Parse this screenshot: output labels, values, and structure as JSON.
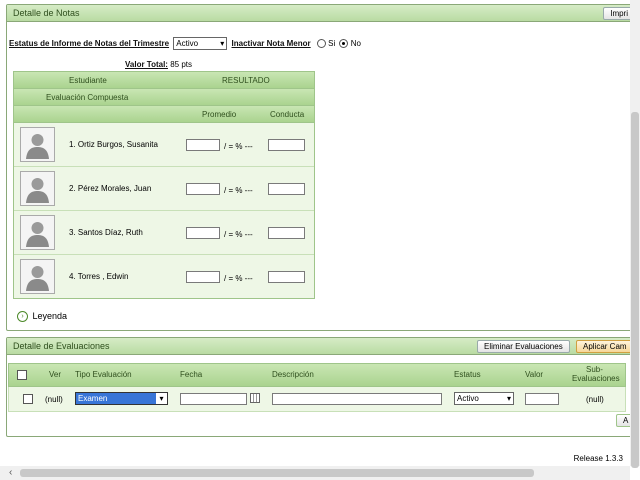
{
  "notas": {
    "title": "Detalle de Notas",
    "print_label": "Impri",
    "status_label": "Estatus de Informe de Notas del Trimestre",
    "status_value": "Activo",
    "inactivar_label": "Inactivar Nota Menor",
    "si_label": "Si",
    "no_label": "No",
    "valor_total_label": "Valor Total:",
    "valor_total_value": "85 pts",
    "headers": {
      "estudiante": "Estudiante",
      "resultado": "RESULTADO",
      "evaluacion": "Evaluación Compuesta",
      "promedio": "Promedio",
      "conducta": "Conducta"
    },
    "pct_label": "/ = % ---",
    "students": [
      {
        "name": "1. Ortiz Burgos, Susanita"
      },
      {
        "name": "2. Pérez Morales, Juan"
      },
      {
        "name": "3. Santos Díaz, Ruth"
      },
      {
        "name": "4. Torres , Edwin"
      }
    ],
    "leyenda": "Leyenda"
  },
  "evaluaciones": {
    "title": "Detalle de Evaluaciones",
    "eliminar_label": "Eliminar Evaluaciones",
    "aplicar_label": "Aplicar Cam",
    "columns": {
      "ver": "Ver",
      "tipo": "Tipo Evaluación",
      "fecha": "Fecha",
      "descripcion": "Descripción",
      "estatus": "Estatus",
      "valor": "Valor",
      "sub1": "Sub-",
      "sub2": "Evaluaciones"
    },
    "row": {
      "ver": "(null)",
      "tipo": "Examen",
      "estatus": "Activo",
      "sub": "(null)"
    },
    "add_label": "A"
  },
  "footer": {
    "release": "Release 1.3.3"
  },
  "colors": {
    "header_green": "#b9dba3",
    "row_green": "#eef7e6",
    "border_green": "#8aa878",
    "select_highlight": "#3875d7"
  }
}
